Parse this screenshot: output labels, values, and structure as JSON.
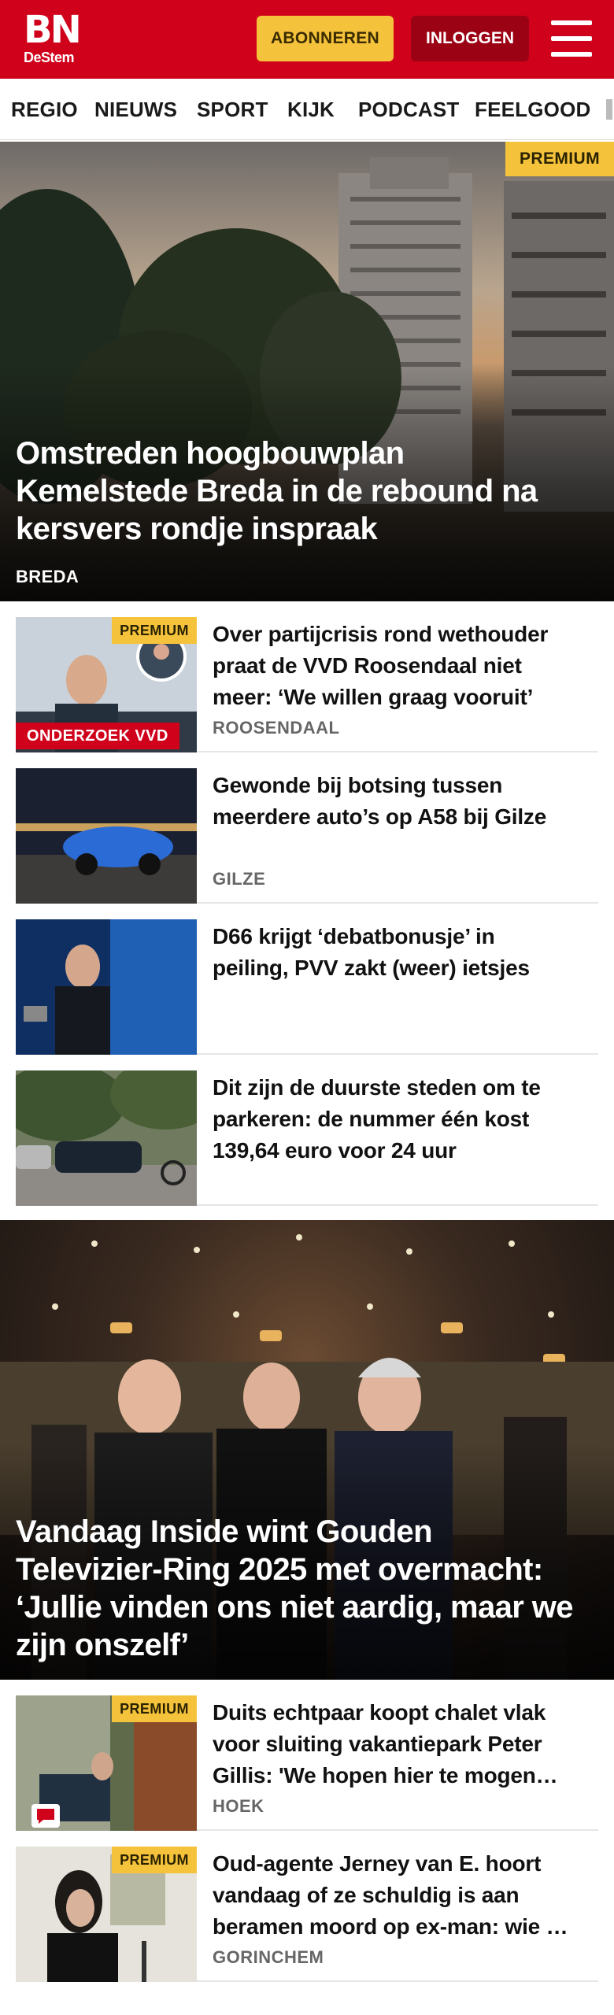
{
  "brand": {
    "name": "BN",
    "sub": "DeStem",
    "color": "#d0021b"
  },
  "header": {
    "subscribe_label": "ABONNEREN",
    "login_label": "INLOGGEN",
    "menu_icon": "hamburger-icon"
  },
  "nav": {
    "items": [
      "REGIO",
      "NIEUWS",
      "SPORT",
      "KIJK",
      "PODCAST",
      "FEELGOOD"
    ]
  },
  "hero": {
    "badge": "PREMIUM",
    "title_lines": [
      "Omstreden hoogbouwplan",
      "Kemelstede Breda in de rebound na",
      "kersvers rondje inspraak"
    ],
    "location": "BREDA"
  },
  "articles": [
    {
      "badge": "PREMIUM",
      "label": "ONDERZOEK VVD",
      "title_lines": [
        "Over partijcrisis rond wethouder",
        "praat de VVD Roosendaal niet",
        "meer: ‘We willen graag vooruit’"
      ],
      "location": "ROOSENDAAL"
    },
    {
      "title_lines": [
        "Gewonde bij botsing tussen",
        "meerdere auto’s op A58 bij Gilze"
      ],
      "location": "GILZE"
    },
    {
      "title_lines": [
        "D66 krijgt ‘debatbonusje’ in",
        "peiling, PVV zakt (weer) ietsjes"
      ]
    },
    {
      "title_lines": [
        "Dit zijn de duurste steden om te",
        "parkeren: de nummer één kost",
        "139,64 euro voor 24 uur"
      ]
    }
  ],
  "hero2": {
    "title_lines": [
      "Vandaag Inside wint Gouden",
      "Televizier-Ring 2025 met overmacht:",
      "‘Jullie vinden ons niet aardig, maar we",
      "zijn onszelf’"
    ]
  },
  "articles2": [
    {
      "badge": "PREMIUM",
      "title_lines": [
        "Duits echtpaar koopt chalet vlak",
        "voor sluiting vakantiepark Peter",
        "Gillis: 'We hopen hier te mogen…"
      ],
      "location": "HOEK"
    },
    {
      "badge": "PREMIUM",
      "title_lines": [
        "Oud-agente Jerney van E. hoort",
        "vandaag of ze schuldig is aan",
        "beramen moord op ex-man: wie …"
      ],
      "location": "GORINCHEM"
    }
  ]
}
